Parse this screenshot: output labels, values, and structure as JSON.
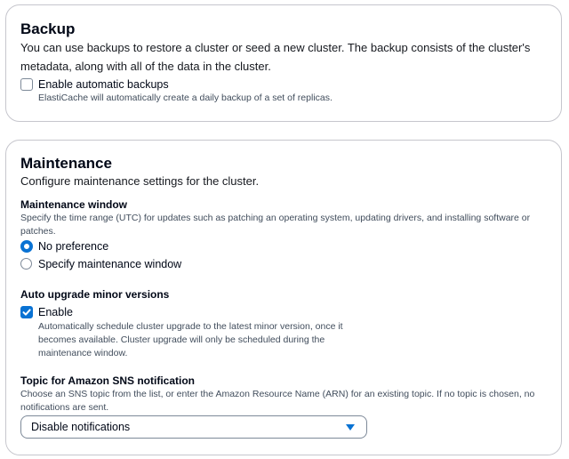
{
  "backup": {
    "title": "Backup",
    "description": "You can use backups to restore a cluster or seed a new cluster. The backup consists of the cluster's metadata, along with all of the data in the cluster.",
    "auto_backup_label": "Enable automatic backups",
    "auto_backup_help": "ElastiCache will automatically create a daily backup of a set of replicas.",
    "auto_backup_checked": false
  },
  "maintenance": {
    "title": "Maintenance",
    "description": "Configure maintenance settings for the cluster.",
    "window": {
      "label": "Maintenance window",
      "description": "Specify the time range (UTC) for updates such as patching an operating system, updating drivers, and installing software or patches.",
      "options": [
        "No preference",
        "Specify maintenance window"
      ],
      "selected": "No preference"
    },
    "auto_upgrade": {
      "label": "Auto upgrade minor versions",
      "checkbox_label": "Enable",
      "checked": true,
      "help": "Automatically schedule cluster upgrade to the latest minor version, once it becomes available. Cluster upgrade will only be scheduled during the maintenance window."
    },
    "sns": {
      "label": "Topic for Amazon SNS notification",
      "description": "Choose an SNS topic from the list, or enter the Amazon Resource Name (ARN) for an existing topic. If no topic is chosen, no notifications are sent.",
      "selected_value": "Disable notifications"
    }
  },
  "colors": {
    "accent": "#0972d3",
    "border": "#c6c6cd",
    "text": "#000716",
    "secondary_text": "#414d5c"
  }
}
